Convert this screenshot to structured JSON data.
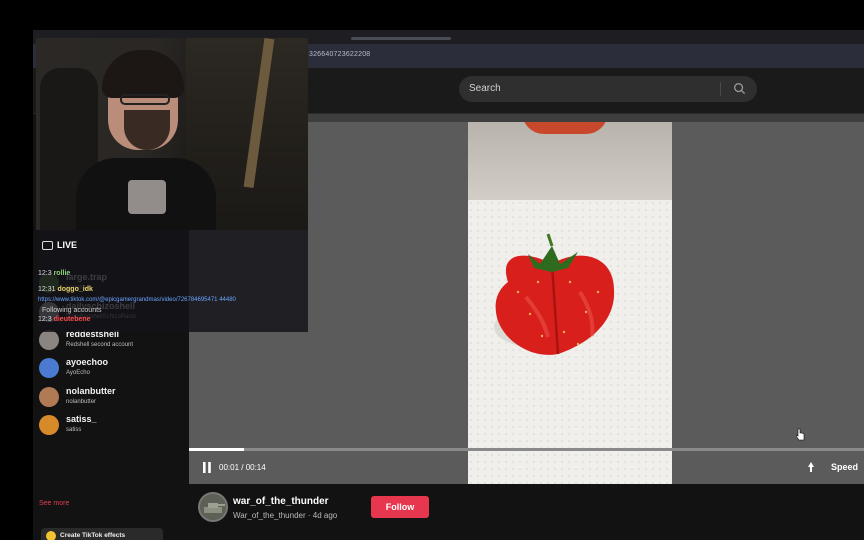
{
  "browser": {
    "url": "326640723622208"
  },
  "header": {
    "search_placeholder": "Search",
    "search_icon": "search-icon"
  },
  "sidebar": {
    "following_label": "Following accounts",
    "accounts": [
      {
        "name": "large.trap",
        "sub": "largetrap",
        "color": "#5c8a3a"
      },
      {
        "name": "dailyschizoshell",
        "sub": "DailyRedshellSchizoRants",
        "color": "#d0d0d0"
      },
      {
        "name": "reddestshell",
        "sub": "Redshell second account",
        "color": "#8a8580"
      },
      {
        "name": "ayoechoo",
        "sub": "AyoEcho",
        "color": "#4a7bd0"
      },
      {
        "name": "nolanbutter",
        "sub": "nolanbutter",
        "color": "#b07a55"
      },
      {
        "name": "satiss_",
        "sub": "satiss",
        "color": "#d68a2a"
      }
    ],
    "see_more": "See more",
    "effects_label": "Create TikTok effects"
  },
  "chat": {
    "live_label": "LIVE",
    "lines": [
      {
        "time": "12:3",
        "name": "rollie",
        "text": ""
      },
      {
        "time": "12:31",
        "name": "doggo_idk",
        "text": ""
      },
      {
        "time": "",
        "name": "",
        "text": "https://www.tiktok.com/@epicgamergrandmas/video/726784695471 44480"
      },
      {
        "time": "12:3",
        "name": "dieutebene",
        "text": ""
      }
    ]
  },
  "player": {
    "time": "00:01 / 00:14",
    "speed_label": "Speed",
    "progress": 0.081
  },
  "author": {
    "name": "war_of_the_thunder",
    "sub": "War_of_the_thunder · 4d ago",
    "follow_label": "Follow"
  }
}
